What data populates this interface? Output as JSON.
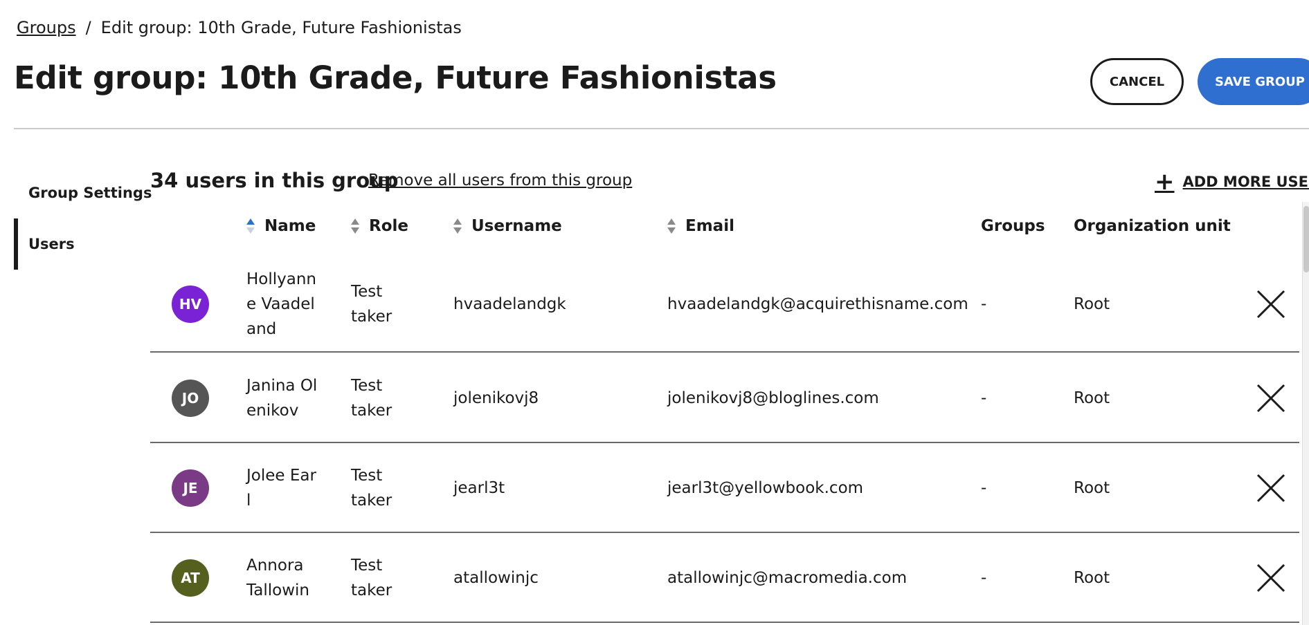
{
  "breadcrumb": {
    "parent": "Groups",
    "separator": "/",
    "current": "Edit group: 10th Grade, Future Fashionistas"
  },
  "page": {
    "title": "Edit group: 10th Grade, Future Fashionistas"
  },
  "actions": {
    "cancel": "CANCEL",
    "save": "SAVE GROUP"
  },
  "sidebar": {
    "items": [
      {
        "label": "Group Settings"
      },
      {
        "label": "Users",
        "active": true
      }
    ]
  },
  "users_section": {
    "heading": "34 users in this group",
    "remove_all": "Remove all users from this group",
    "add_more": "ADD MORE USERS",
    "columns": {
      "name": "Name",
      "role": "Role",
      "username": "Username",
      "email": "Email",
      "groups": "Groups",
      "org_unit": "Organization unit"
    },
    "rows": [
      {
        "initials": "HV",
        "color": "#7a22d6",
        "name_lines": [
          "Hollyann",
          "e Vaadel",
          "and"
        ],
        "role_lines": [
          "Test",
          "taker"
        ],
        "username": "hvaadelandgk",
        "email": "hvaadelandgk@acquirethisname.com",
        "groups": "-",
        "org_unit": "Root"
      },
      {
        "initials": "JO",
        "color": "#555555",
        "name_lines": [
          "Janina Ol",
          "enikov"
        ],
        "role_lines": [
          "Test",
          "taker"
        ],
        "username": "jolenikovj8",
        "email": "jolenikovj8@bloglines.com",
        "groups": "-",
        "org_unit": "Root"
      },
      {
        "initials": "JE",
        "color": "#7b3a86",
        "name_lines": [
          "Jolee Ear",
          "l"
        ],
        "role_lines": [
          "Test",
          "taker"
        ],
        "username": "jearl3t",
        "email": "jearl3t@yellowbook.com",
        "groups": "-",
        "org_unit": "Root"
      },
      {
        "initials": "AT",
        "color": "#56601e",
        "name_lines": [
          "Annora",
          "Tallowin"
        ],
        "role_lines": [
          "Test",
          "taker"
        ],
        "username": "atallowinjc",
        "email": "atallowinjc@macromedia.com",
        "groups": "-",
        "org_unit": "Root"
      }
    ]
  },
  "colors": {
    "accent": "#2e6fd0",
    "text": "#1b1b1b"
  }
}
